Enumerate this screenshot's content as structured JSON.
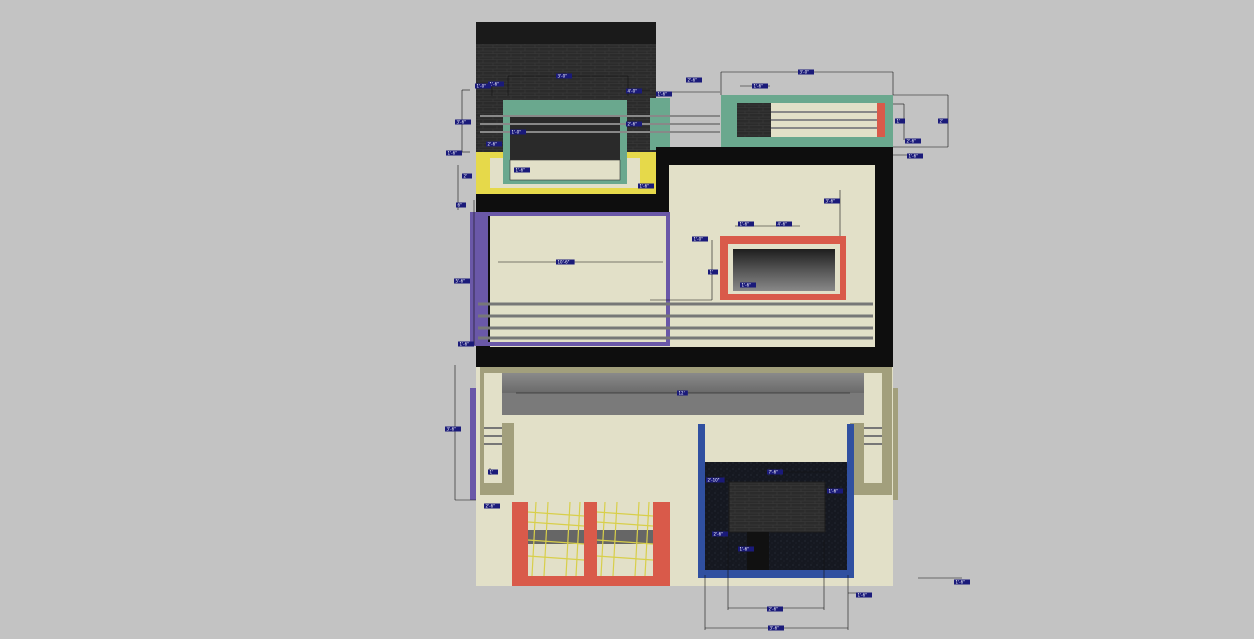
{
  "colors": {
    "background": "#c3c3c3",
    "wall": "#e2e0c8",
    "black_frame": "#0e0e0e",
    "teal": "#6aa88e",
    "yellow": "#e6d94a",
    "purple": "#6a58a8",
    "red": "#d95a4a",
    "blue": "#3050a0",
    "khaki": "#a29f7c",
    "stone": "#2a2a2a",
    "grey_slab": "#7f7f7f",
    "dim_label": "#1a1a7a"
  },
  "dimensions": {
    "d01": "3'-6\"",
    "d02": "1'-6\"",
    "d03": "1'-0\"",
    "d04": "2'-6\"",
    "d05": "1'-6\"",
    "d06": "1'-0\"",
    "d07": "2'-6\"",
    "d08": "3'-0\"",
    "d09": "4'-0\"",
    "d10": "2'-6\"",
    "d11": "3'-0\"",
    "d12": "1'-6\"",
    "d13": "1'-6\"",
    "d14": "2'",
    "d15": "6\"",
    "d16": "1'-6\"",
    "d17": "1'-6\"",
    "d18": "1'",
    "d19": "2'",
    "d20": "2'-6\"",
    "d21": "1'-6\"",
    "d22": "1'-0\"",
    "d23": "10'-6\"",
    "d24": "1'-6\"",
    "d25": "3'-6\"",
    "d26": "1'",
    "d27": "5'-6\"",
    "d28": "12'",
    "d29": "3'-6\"",
    "d30": "1'",
    "d31": "2'-6\"",
    "d32": "2'-10\"",
    "d33": "7'-6\"",
    "d34": "1'-6\"",
    "d35": "2'-6\"",
    "d36": "1'-6\"",
    "d37": "1'-6\"",
    "d38": "2'-6\"",
    "d39": "3'-6\"",
    "d40": "1'-6\"",
    "d41": "4'-6\"",
    "d42": "1'-6\"",
    "d43": "1'-6\""
  }
}
